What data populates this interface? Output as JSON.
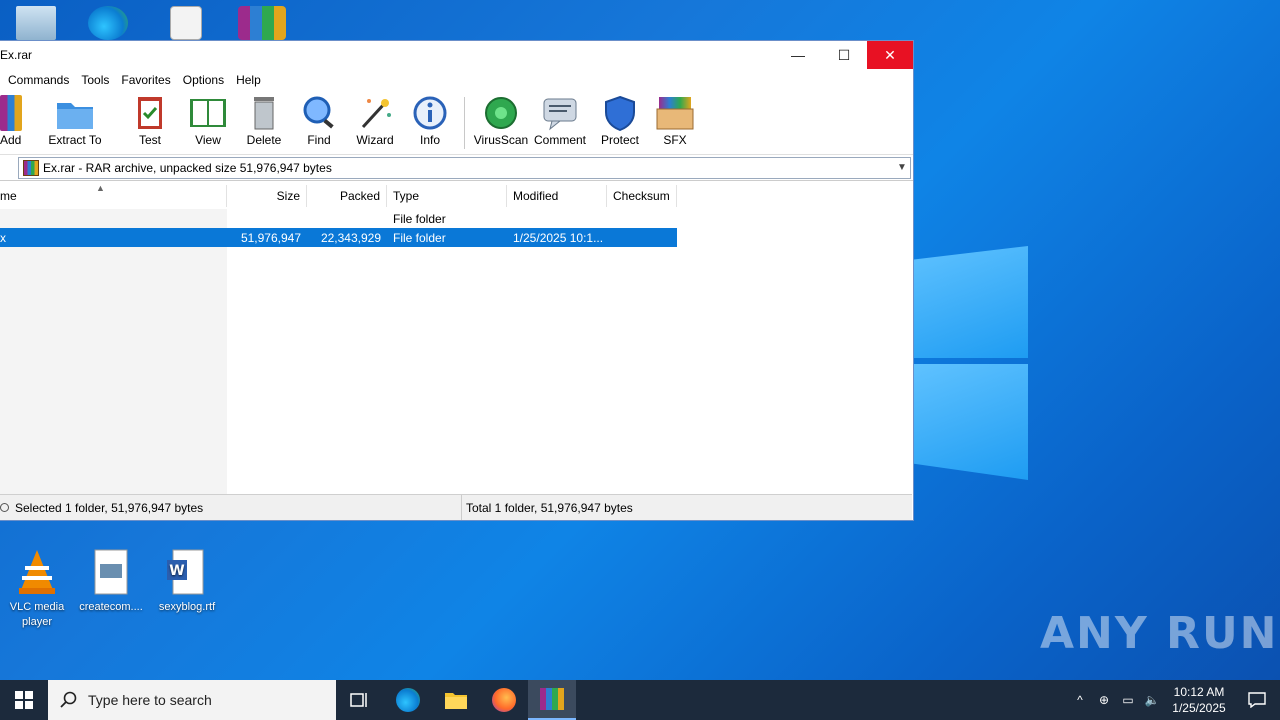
{
  "desktop": {
    "icons": [
      {
        "label": "VLC media player",
        "icon": "vlc-icon"
      },
      {
        "label": "createcom....",
        "icon": "image-file-icon"
      },
      {
        "label": "sexyblog.rtf",
        "icon": "word-doc-icon"
      }
    ],
    "watermark": "ANY RUN"
  },
  "window": {
    "title": "Ex.rar",
    "controls": {
      "minimize": "—",
      "maximize": "☐",
      "close": "✕"
    },
    "menu": [
      "Commands",
      "Tools",
      "Favorites",
      "Options",
      "Help"
    ],
    "toolbar": [
      {
        "label": "Add",
        "icon": "add-archive-icon"
      },
      {
        "label": "Extract To",
        "icon": "extract-folder-icon"
      },
      {
        "label": "Test",
        "icon": "test-clipboard-icon"
      },
      {
        "label": "View",
        "icon": "view-book-icon"
      },
      {
        "label": "Delete",
        "icon": "trash-icon"
      },
      {
        "label": "Find",
        "icon": "magnifier-icon"
      },
      {
        "label": "Wizard",
        "icon": "wand-icon"
      },
      {
        "label": "Info",
        "icon": "info-icon"
      },
      {
        "label": "VirusScan",
        "icon": "virus-scan-icon"
      },
      {
        "label": "Comment",
        "icon": "comment-icon"
      },
      {
        "label": "Protect",
        "icon": "shield-icon"
      },
      {
        "label": "SFX",
        "icon": "sfx-box-icon"
      }
    ],
    "address": "Ex.rar - RAR archive, unpacked size 51,976,947 bytes",
    "columns": {
      "name": "me",
      "size": "Size",
      "packed": "Packed",
      "type": "Type",
      "modified": "Modified",
      "checksum": "Checksum"
    },
    "rows": [
      {
        "name": "",
        "size": "",
        "packed": "",
        "type": "File folder",
        "modified": "",
        "checksum": ""
      },
      {
        "name": "x",
        "size": "51,976,947",
        "packed": "22,343,929",
        "type": "File folder",
        "modified": "1/25/2025 10:1...",
        "checksum": ""
      }
    ],
    "status": {
      "left": "Selected 1 folder, 51,976,947 bytes",
      "right": "Total 1 folder, 51,976,947 bytes"
    }
  },
  "taskbar": {
    "search_placeholder": "Type here to search",
    "time": "10:12 AM",
    "date": "1/25/2025"
  },
  "colors": {
    "selection": "#0a78d7",
    "close": "#e81123",
    "taskbar": "#1c2a3c"
  }
}
